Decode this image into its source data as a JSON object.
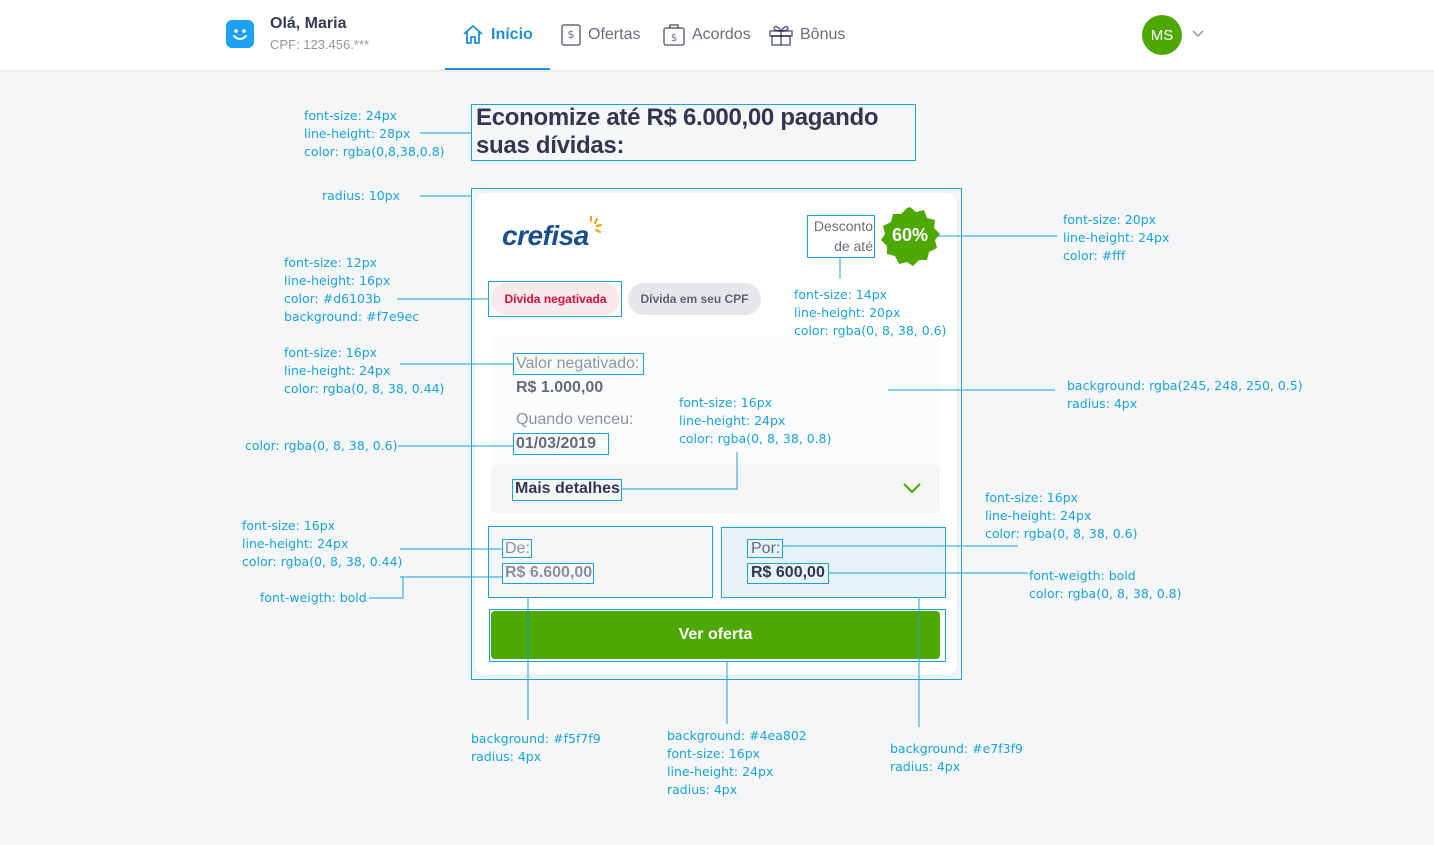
{
  "header": {
    "greeting": "Olá, Maria",
    "cpf": "CPF: 123.456.***",
    "nav": [
      {
        "label": "Início",
        "icon": "home-icon",
        "active": true
      },
      {
        "label": "Ofertas",
        "icon": "offers-icon",
        "active": false
      },
      {
        "label": "Acordos",
        "icon": "agreements-icon",
        "active": false
      },
      {
        "label": "Bônus",
        "icon": "gift-icon",
        "active": false
      }
    ],
    "avatar_initials": "MS"
  },
  "main": {
    "title": "Economize até R$ 6.000,00 pagando suas dívidas:"
  },
  "card": {
    "brand": "crefisa",
    "discount_label": "Desconto de até",
    "discount_value": "60%",
    "chips": [
      "Dívida negativada",
      "Dívida em seu CPF"
    ],
    "negative_value_label": "Valor negativado:",
    "negative_value": "R$ 1.000,00",
    "due_label": "Quando venceu:",
    "due_date": "01/03/2019",
    "details_label": "Mais detalhes",
    "from_label": "De:",
    "from_value": "R$ 6.600,00",
    "to_label": "Por:",
    "to_value": "R$ 600,00",
    "cta_label": "Ver oferta"
  },
  "annotations": {
    "title_spec": "font-size: 24px\nline-height: 28px\ncolor: rgba(0,8,38,0.8)",
    "card_radius": "radius: 10px",
    "chip_spec": "font-size: 12px\nline-height: 16px\ncolor: #d6103b\nbackground: #f7e9ec",
    "label_spec": "font-size: 16px\nline-height: 24px\ncolor: rgba(0, 8, 38, 0.44)",
    "date_color": "color: rgba(0, 8, 38, 0.6)",
    "details_spec": "font-size: 16px\nline-height: 24px\ncolor: rgba(0, 8, 38, 0.8)",
    "from_label_spec": "font-size: 16px\nline-height: 24px\ncolor: rgba(0, 8, 38, 0.44)",
    "from_weight": "font-weigth: bold",
    "desc_spec": "font-size: 14px\nline-height: 20px\ncolor: rgba(0, 8, 38, 0.6)",
    "badge_spec": "font-size: 20px\nline-height: 24px\ncolor: #fff",
    "info_bg_spec": "background: rgba(245, 248, 250, 0.5)\nradius: 4px",
    "to_label_spec": "font-size: 16px\nline-height: 24px\ncolor: rgba(0, 8, 38, 0.6)",
    "to_value_spec": "font-weigth: bold\ncolor: rgba(0, 8, 38, 0.8)",
    "from_bg_spec": "background: #f5f7f9\nradius: 4px",
    "cta_spec": "background: #4ea802\nfont-size: 16px\nline-height: 24px\nradius: 4px",
    "to_bg_spec": "background: #e7f3f9\nradius: 4px"
  },
  "colors": {
    "accent": "#1d8fd8",
    "green": "#4ea802",
    "annotation": "#1aa3d5",
    "danger": "#d6103b"
  }
}
